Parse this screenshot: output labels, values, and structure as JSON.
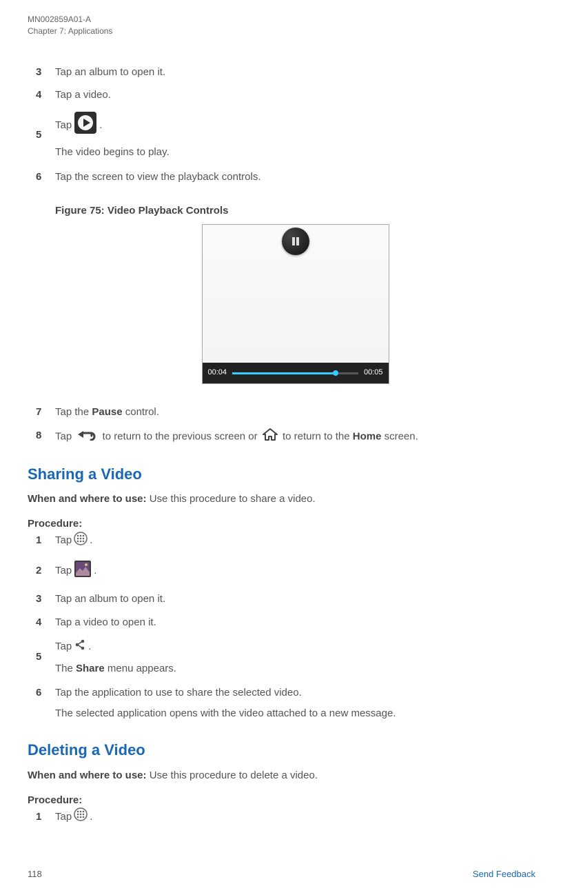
{
  "header": {
    "doc_id": "MN002859A01-A",
    "chapter": "Chapter 7:  Applications"
  },
  "first_steps": {
    "s3": {
      "num": "3",
      "text": "Tap an album to open it."
    },
    "s4": {
      "num": "4",
      "text": "Tap a video."
    },
    "s5": {
      "num": "5",
      "text_a": "Tap ",
      "text_b": ".",
      "sub": "The video begins to play."
    },
    "s6": {
      "num": "6",
      "text": "Tap the screen to view the playback controls."
    }
  },
  "figure": {
    "caption": "Figure 75: Video Playback Controls",
    "time_elapsed": "00:04",
    "time_total": "00:05"
  },
  "after_fig": {
    "s7": {
      "num": "7",
      "text_a": "Tap the ",
      "bold": "Pause",
      "text_b": " control."
    },
    "s8": {
      "num": "8",
      "text_a": "Tap ",
      "text_b": " to return to the previous screen or ",
      "text_c": " to return to the ",
      "bold": "Home",
      "text_d": " screen."
    }
  },
  "sharing": {
    "title": "Sharing a Video",
    "when_label": "When and where to use: ",
    "when_text": "Use this procedure to share a video.",
    "proc_label": "Procedure:",
    "s1": {
      "num": "1",
      "text_a": "Tap ",
      "text_b": "."
    },
    "s2": {
      "num": "2",
      "text_a": "Tap ",
      "text_b": "."
    },
    "s3": {
      "num": "3",
      "text": "Tap an album to open it."
    },
    "s4": {
      "num": "4",
      "text": "Tap a video to open it."
    },
    "s5": {
      "num": "5",
      "text_a": "Tap ",
      "text_b": ".",
      "sub_a": "The ",
      "sub_bold": "Share",
      "sub_b": " menu appears."
    },
    "s6": {
      "num": "6",
      "text": "Tap the application to use to share the selected video.",
      "sub": "The selected application opens with the video attached to a new message."
    }
  },
  "deleting": {
    "title": "Deleting a Video",
    "when_label": "When and where to use: ",
    "when_text": "Use this procedure to delete a video.",
    "proc_label": "Procedure:",
    "s1": {
      "num": "1",
      "text_a": "Tap ",
      "text_b": "."
    }
  },
  "footer": {
    "page": "118",
    "feedback": "Send Feedback"
  }
}
